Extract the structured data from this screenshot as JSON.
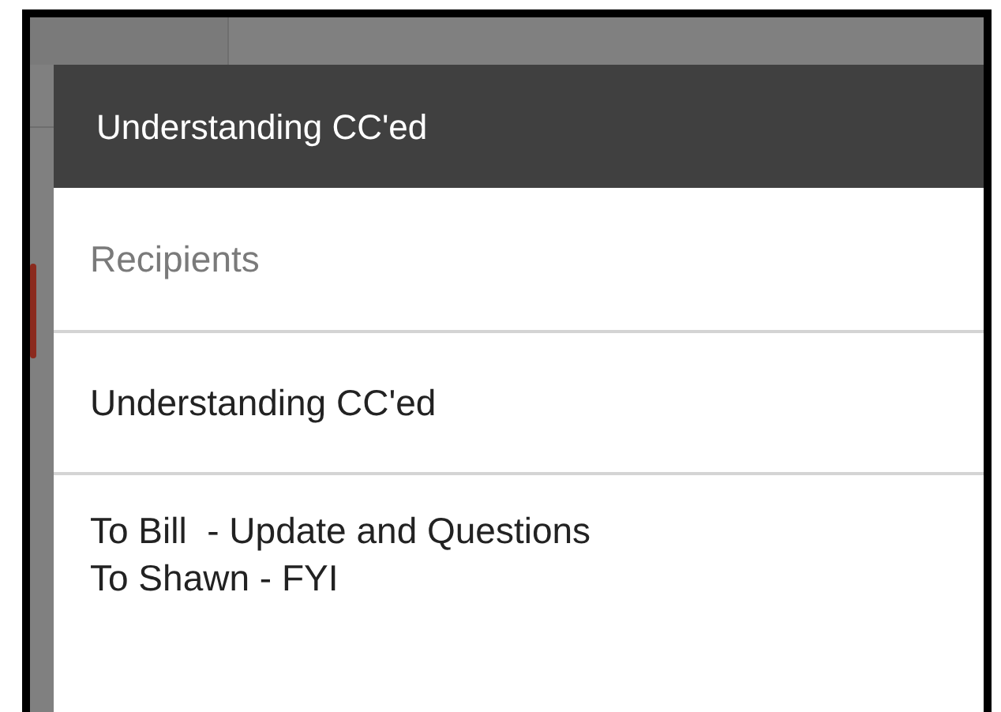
{
  "dialog": {
    "title": "Understanding CC'ed"
  },
  "recipients": {
    "placeholder": "Recipients"
  },
  "subject": {
    "value": "Understanding CC'ed"
  },
  "body": {
    "value": "To Bill  - Update and Questions\nTo Shawn - FYI"
  }
}
